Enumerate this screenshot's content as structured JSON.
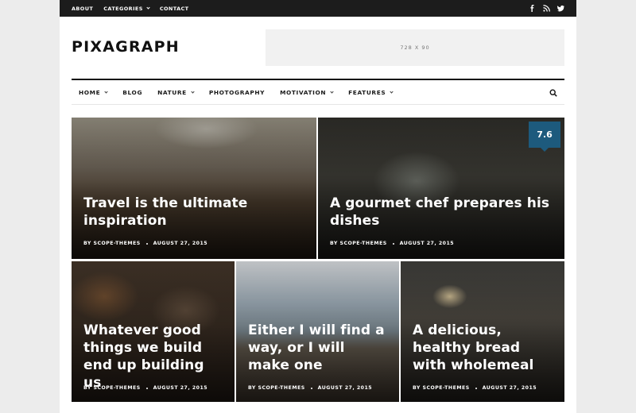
{
  "topbar": {
    "links": [
      {
        "label": "ABOUT"
      },
      {
        "label": "CATEGORIES"
      },
      {
        "label": "CONTACT"
      }
    ],
    "social_icons": [
      "facebook-icon",
      "rss-icon",
      "twitter-icon"
    ]
  },
  "header": {
    "logo": "PIXAGRAPH",
    "ad_label": "728 X 90"
  },
  "nav": {
    "items": [
      {
        "label": "HOME"
      },
      {
        "label": "BLOG"
      },
      {
        "label": "NATURE"
      },
      {
        "label": "PHOTOGRAPHY"
      },
      {
        "label": "MOTIVATION"
      },
      {
        "label": "FEATURES"
      }
    ]
  },
  "posts": [
    {
      "title": "Travel is the ultimate inspiration",
      "author": "BY SCOPE-THEMES",
      "date": "AUGUST 27, 2015"
    },
    {
      "title": "A gourmet chef prepares his dishes",
      "author": "BY SCOPE-THEMES",
      "date": "AUGUST 27, 2015",
      "score": "7.6"
    },
    {
      "title": "Whatever good things we build end up building us",
      "author": "BY SCOPE-THEMES",
      "date": "AUGUST 27, 2015"
    },
    {
      "title": "Either I will find a way, or I will make one",
      "author": "BY SCOPE-THEMES",
      "date": "AUGUST 27, 2015"
    },
    {
      "title": "A delicious, healthy bread with wholemeal",
      "author": "BY SCOPE-THEMES",
      "date": "AUGUST 27, 2015"
    }
  ],
  "colors": {
    "topbar_bg": "#1c1c1c",
    "score_badge": "#1d5a7d",
    "page_bg": "#ececec"
  }
}
